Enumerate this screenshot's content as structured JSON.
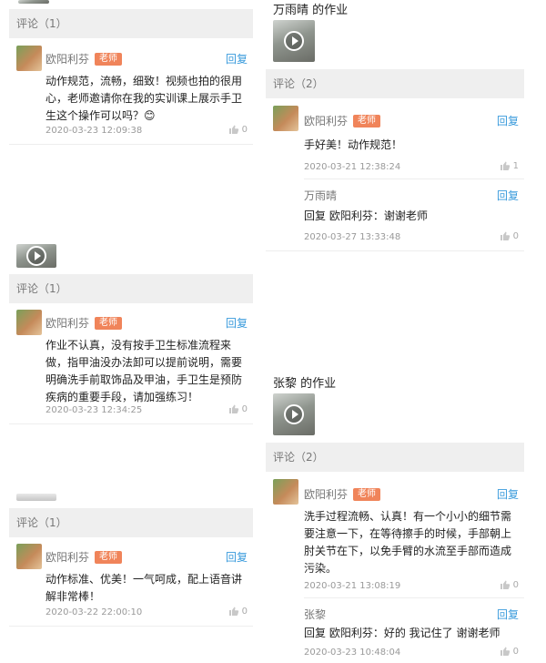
{
  "left": {
    "blocks": [
      {
        "comment_header": "评论（1）",
        "comments": [
          {
            "name": "欧阳利芬",
            "badge": "老师",
            "reply": "回复",
            "text": "动作规范，流畅，细致！视频也拍的很用心，老师邀请你在我的实训课上展示手卫生这个操作可以吗？😊",
            "time": "2020-03-23 12:09:38",
            "likes": "0"
          }
        ]
      },
      {
        "comment_header": "评论（1）",
        "comments": [
          {
            "name": "欧阳利芬",
            "badge": "老师",
            "reply": "回复",
            "text": "作业不认真，没有按手卫生标准流程来做，指甲油没办法卸可以提前说明，需要明确洗手前取饰品及甲油，手卫生是预防疾病的重要手段，请加强练习！",
            "time": "2020-03-23 12:34:25",
            "likes": "0"
          }
        ]
      },
      {
        "comment_header": "评论（1）",
        "comments": [
          {
            "name": "欧阳利芬",
            "badge": "老师",
            "reply": "回复",
            "text": "动作标准、优美！一气呵成，配上语音讲解非常棒！",
            "time": "2020-03-22 22:00:10",
            "likes": "0"
          }
        ]
      }
    ]
  },
  "right": {
    "blocks": [
      {
        "title": "万雨晴 的作业",
        "comment_header": "评论（2）",
        "comments": [
          {
            "name": "欧阳利芬",
            "badge": "老师",
            "reply": "回复",
            "text": "手好美！动作规范！",
            "time": "2020-03-21 12:38:24",
            "likes": "1"
          },
          {
            "name": "万雨晴",
            "reply": "回复",
            "text": "回复 欧阳利芬：谢谢老师",
            "time": "2020-03-27 13:33:48",
            "likes": "0"
          }
        ]
      },
      {
        "title": "张黎 的作业",
        "comment_header": "评论（2）",
        "comments": [
          {
            "name": "欧阳利芬",
            "badge": "老师",
            "reply": "回复",
            "text": "洗手过程流畅、认真！有一个小小的细节需要注意一下，在等待擦手的时候，手部朝上肘关节在下，以免手臂的水流至手部而造成污染。",
            "time": "2020-03-21 13:08:19",
            "likes": "0"
          },
          {
            "name": "张黎",
            "reply": "回复",
            "text": "回复 欧阳利芬：好的 我记住了 谢谢老师",
            "time": "2020-03-23 10:48:04",
            "likes": "0"
          }
        ]
      }
    ]
  },
  "colors": {
    "accent_blue": "#3a9bdc",
    "badge_orange": "#f0845a",
    "bar_gray": "#efefef"
  },
  "icons": {
    "play": "play-icon",
    "like": "thumbs-up-icon"
  }
}
